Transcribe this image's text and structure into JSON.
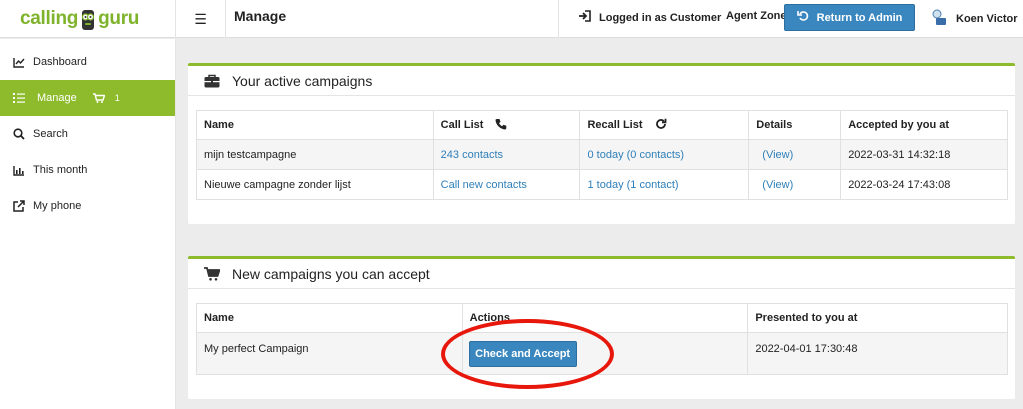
{
  "app": {
    "logo_left": "calling",
    "logo_right": "guru",
    "page_title": "Manage"
  },
  "header": {
    "logged_in_label": "Logged in as Customer",
    "agent_zone_label": "Agent Zone",
    "return_label": "Return to Admin",
    "user_name": "Koen Victor"
  },
  "sidebar": {
    "items": [
      {
        "label": "Dashboard",
        "icon": "chart-line-icon"
      },
      {
        "label": "Manage",
        "icon": "list-icon",
        "cart_count": "1"
      },
      {
        "label": "Search",
        "icon": "search-icon"
      },
      {
        "label": "This month",
        "icon": "bar-chart-icon"
      },
      {
        "label": "My phone",
        "icon": "external-link-icon"
      }
    ]
  },
  "active_campaigns": {
    "title": "Your active campaigns",
    "headers": {
      "name": "Name",
      "call_list": "Call List",
      "recall_list": "Recall List",
      "details": "Details",
      "accepted": "Accepted by you at"
    },
    "rows": [
      {
        "name": "mijn testcampagne",
        "call_list": "243 contacts",
        "recall_list": "0 today (0 contacts)",
        "details": "(View)",
        "accepted": "2022-03-31 14:32:18"
      },
      {
        "name": "Nieuwe campagne zonder lijst",
        "call_list": "Call new contacts",
        "recall_list": "1 today (1 contact)",
        "details": "(View)",
        "accepted": "2022-03-24 17:43:08"
      }
    ]
  },
  "new_campaigns": {
    "title": "New campaigns you can accept",
    "headers": {
      "name": "Name",
      "actions": "Actions",
      "presented": "Presented to you at"
    },
    "rows": [
      {
        "name": "My perfect Campaign",
        "action_label": "Check and Accept",
        "presented": "2022-04-01 17:30:48"
      }
    ]
  },
  "colors": {
    "brand_green": "#8dbb2b",
    "button_blue": "#3a87bf",
    "link_blue": "#2e7fb8",
    "highlight_red": "#e8170c"
  }
}
